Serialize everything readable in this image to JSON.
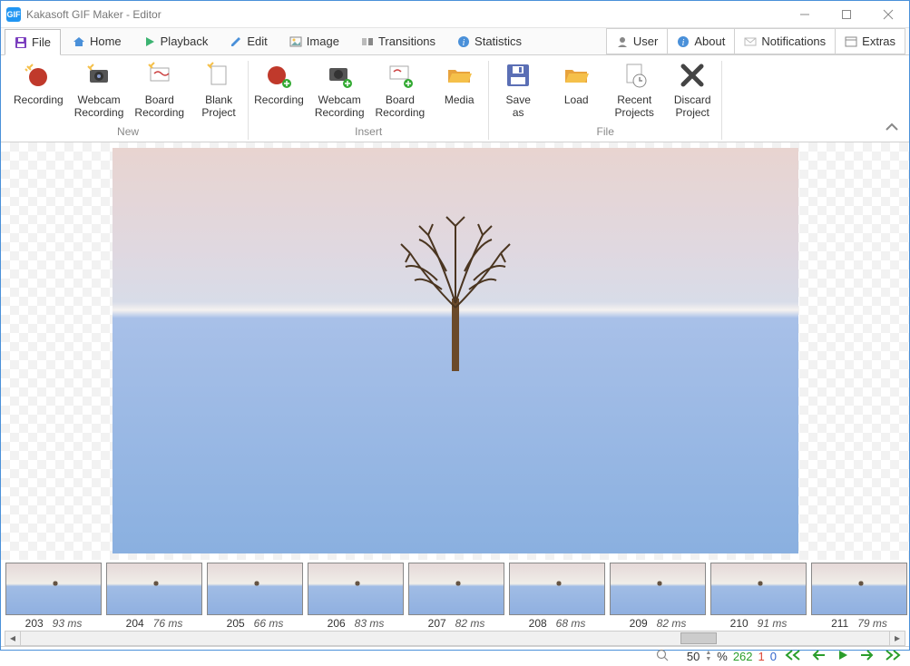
{
  "window": {
    "title": "Kakasoft GIF Maker - Editor",
    "icon_text": "GIF"
  },
  "tabs": {
    "left": [
      {
        "label": "File",
        "icon": "save-icon",
        "active": true,
        "color": "#7b3fbf"
      },
      {
        "label": "Home",
        "icon": "home-icon",
        "color": "#4a90d9"
      },
      {
        "label": "Playback",
        "icon": "play-icon",
        "color": "#3cb371"
      },
      {
        "label": "Edit",
        "icon": "pencil-icon",
        "color": "#4a90d9"
      },
      {
        "label": "Image",
        "icon": "image-icon",
        "color": "#888"
      },
      {
        "label": "Transitions",
        "icon": "transitions-icon",
        "color": "#888"
      },
      {
        "label": "Statistics",
        "icon": "info-icon",
        "color": "#4a90d9"
      }
    ],
    "right": [
      {
        "label": "User",
        "icon": "user-icon"
      },
      {
        "label": "About",
        "icon": "info-icon"
      },
      {
        "label": "Notifications",
        "icon": "mail-icon"
      },
      {
        "label": "Extras",
        "icon": "window-icon"
      }
    ]
  },
  "ribbon": {
    "groups": [
      {
        "label": "New",
        "items": [
          {
            "label": "Recording",
            "icon": "record-icon"
          },
          {
            "label": "Webcam Recording",
            "icon": "webcam-icon"
          },
          {
            "label": "Board Recording",
            "icon": "board-icon"
          },
          {
            "label": "Blank Project",
            "icon": "blank-icon"
          }
        ]
      },
      {
        "label": "Insert",
        "items": [
          {
            "label": "Recording",
            "icon": "record-add-icon"
          },
          {
            "label": "Webcam Recording",
            "icon": "webcam-add-icon"
          },
          {
            "label": "Board Recording",
            "icon": "board-add-icon"
          },
          {
            "label": "Media",
            "icon": "folder-icon"
          }
        ]
      },
      {
        "label": "File",
        "items": [
          {
            "label": "Save as",
            "icon": "saveas-icon"
          },
          {
            "label": "Load",
            "icon": "folder-open-icon"
          },
          {
            "label": "Recent Projects",
            "icon": "recent-icon"
          },
          {
            "label": "Discard Project",
            "icon": "discard-icon"
          }
        ]
      }
    ]
  },
  "frames": [
    {
      "num": "203",
      "dur": "93 ms"
    },
    {
      "num": "204",
      "dur": "76 ms"
    },
    {
      "num": "205",
      "dur": "66 ms"
    },
    {
      "num": "206",
      "dur": "83 ms"
    },
    {
      "num": "207",
      "dur": "82 ms"
    },
    {
      "num": "208",
      "dur": "68 ms"
    },
    {
      "num": "209",
      "dur": "82 ms"
    },
    {
      "num": "210",
      "dur": "91 ms"
    },
    {
      "num": "211",
      "dur": "79 ms"
    }
  ],
  "status": {
    "zoom": "50",
    "zoom_unit": "%",
    "count_total": "262",
    "count_sel": "1",
    "count_other": "0"
  }
}
